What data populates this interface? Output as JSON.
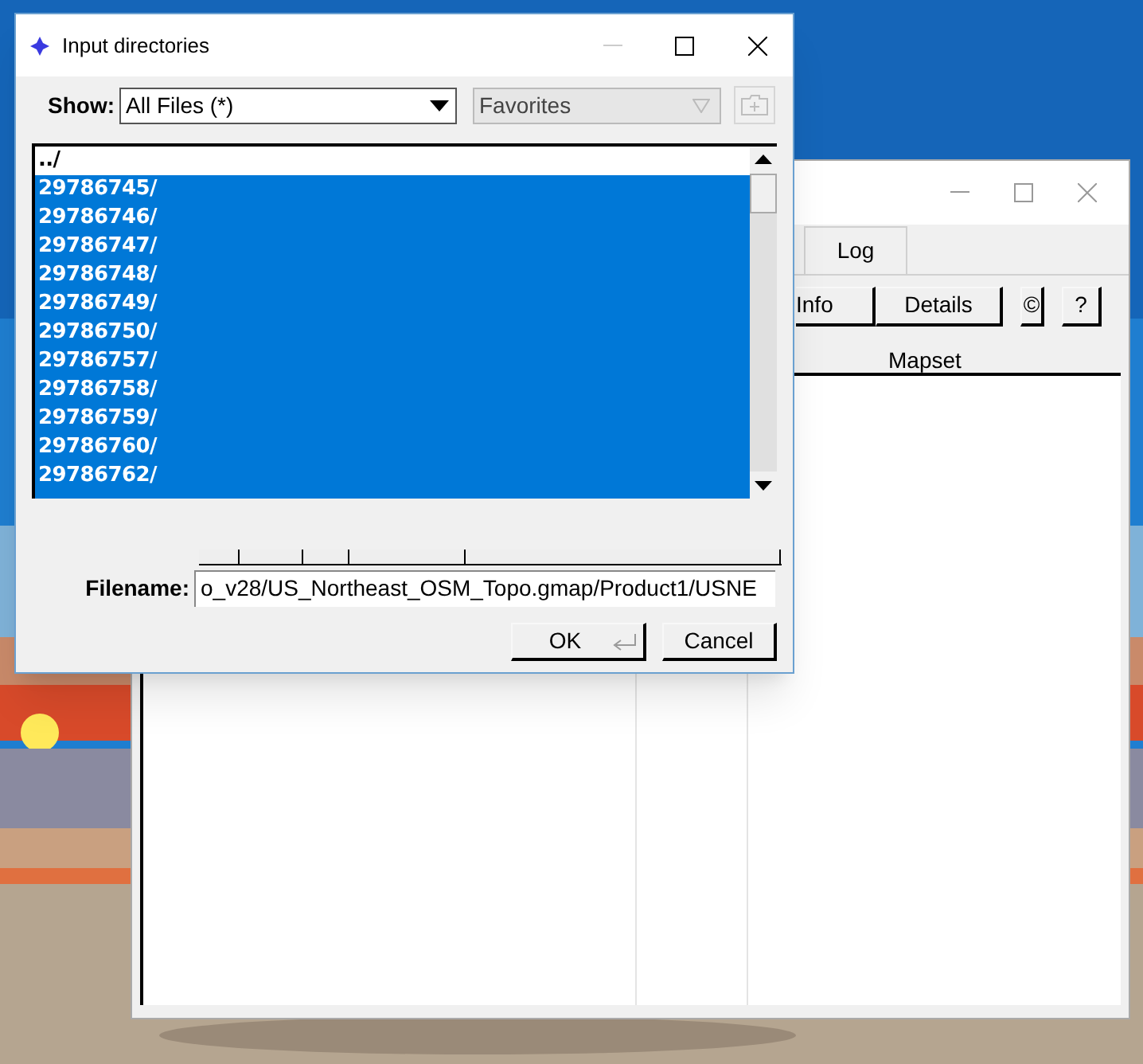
{
  "back_window": {
    "tabs": [
      {
        "label": "Log",
        "selected": false
      }
    ],
    "buttons": [
      {
        "label": "Info"
      },
      {
        "label": "Details"
      },
      {
        "label": "©"
      },
      {
        "label": "?"
      }
    ],
    "table": {
      "columns": [
        "Mapset"
      ]
    }
  },
  "dialog": {
    "title": "Input directories",
    "show": {
      "label": "Show:",
      "value": "All Files (*)"
    },
    "favorites": {
      "value": "Favorites",
      "disabled": true
    },
    "new_folder": {
      "disabled": true
    },
    "files": [
      {
        "name": "../",
        "selected": false
      },
      {
        "name": "29786745/",
        "selected": true
      },
      {
        "name": "29786746/",
        "selected": true
      },
      {
        "name": "29786747/",
        "selected": true
      },
      {
        "name": "29786748/",
        "selected": true
      },
      {
        "name": "29786749/",
        "selected": true
      },
      {
        "name": "29786750/",
        "selected": true
      },
      {
        "name": "29786757/",
        "selected": true
      },
      {
        "name": "29786758/",
        "selected": true
      },
      {
        "name": "29786759/",
        "selected": true
      },
      {
        "name": "29786760/",
        "selected": true
      },
      {
        "name": "29786762/",
        "selected": true
      }
    ],
    "filename": {
      "label": "Filename:",
      "value": "o_v28/US_Northeast_OSM_Topo.gmap/Product1/USNE"
    },
    "buttons": [
      {
        "label": "OK",
        "kind": "default"
      },
      {
        "label": "Cancel",
        "kind": "normal"
      }
    ]
  }
}
